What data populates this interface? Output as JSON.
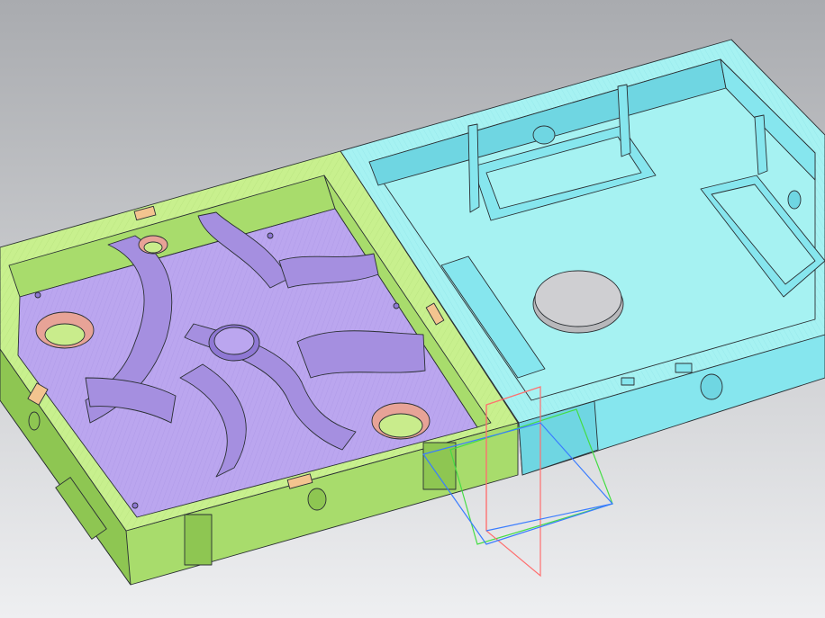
{
  "viewport": {
    "background_top": "#a9abaf",
    "background_bottom": "#eeeff1"
  },
  "colors": {
    "outline": "#2a2f33",
    "green_top": "#c8f08e",
    "green_side": "#a8dc6c",
    "green_dark": "#8ec652",
    "purple_floor": "#bba6ef",
    "purple_wall": "#a58fe0",
    "purple_dark": "#8f78d4",
    "cyan_top": "#a6f2f2",
    "cyan_side": "#86e6ee",
    "cyan_dark": "#6fd6e2",
    "pad_red": "#e7a397",
    "pad_green": "#c9ec8c",
    "disk_gray": "#cfcfd2",
    "tab_orange": "#f3c48f",
    "axis_x": "#ff6f6f",
    "axis_y": "#44dd44",
    "axis_z": "#3a7cff"
  },
  "icons": {
    "origin": "coordinate-origin-icon"
  }
}
